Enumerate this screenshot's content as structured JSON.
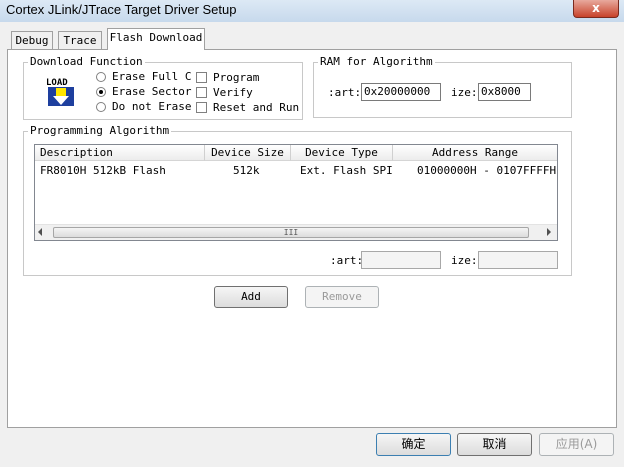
{
  "window": {
    "title": "Cortex JLink/JTrace Target Driver Setup",
    "close_glyph": "x"
  },
  "tabs": [
    {
      "label": "Debug"
    },
    {
      "label": "Trace"
    },
    {
      "label": "Flash Download"
    }
  ],
  "download_function": {
    "title": "Download Function",
    "load_icon_text": "LOAD",
    "radios": [
      {
        "label": "Erase Full C",
        "selected": false
      },
      {
        "label": "Erase Sector",
        "selected": true
      },
      {
        "label": "Do not Erase",
        "selected": false
      }
    ],
    "checkboxes": [
      {
        "label": "Program",
        "checked": false
      },
      {
        "label": "Verify",
        "checked": false
      },
      {
        "label": "Reset and Run",
        "checked": false
      }
    ]
  },
  "ram": {
    "title": "RAM for Algorithm",
    "start_label": ":art:",
    "start_value": "0x20000000",
    "size_label": "ize:",
    "size_value": "0x8000"
  },
  "programming_algorithm": {
    "title": "Programming Algorithm",
    "columns": [
      "Description",
      "Device Size",
      "Device Type",
      "Address Range"
    ],
    "rows": [
      {
        "description": "FR8010H 512kB Flash",
        "size": "512k",
        "type": "Ext. Flash SPI",
        "range": "01000000H - 0107FFFFH"
      }
    ],
    "scroll_thumb_glyph": "III",
    "start_label": ":art:",
    "start_value": "",
    "size_label": "ize:",
    "size_value": ""
  },
  "actions": {
    "add_label": "Add",
    "remove_label": "Remove"
  },
  "footer": {
    "ok_label": "确定",
    "cancel_label": "取消",
    "apply_label": "应用(A)"
  }
}
